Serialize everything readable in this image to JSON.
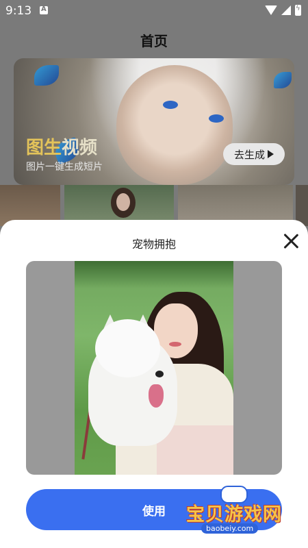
{
  "status_bar": {
    "time": "9:13"
  },
  "page": {
    "title": "首页"
  },
  "banner": {
    "title_part1": "图生",
    "title_part2": "视频",
    "subtitle": "图片一键生成短片",
    "generate_label": "去生成"
  },
  "sheet": {
    "title": "宠物拥抱",
    "use_label": "使用"
  },
  "watermark": {
    "text": "宝贝游戏网",
    "url": "baobeiy.com"
  },
  "colors": {
    "accent": "#3a6ff0",
    "overlay": "#7a7a7a",
    "title_highlight": "#e3c35a"
  }
}
